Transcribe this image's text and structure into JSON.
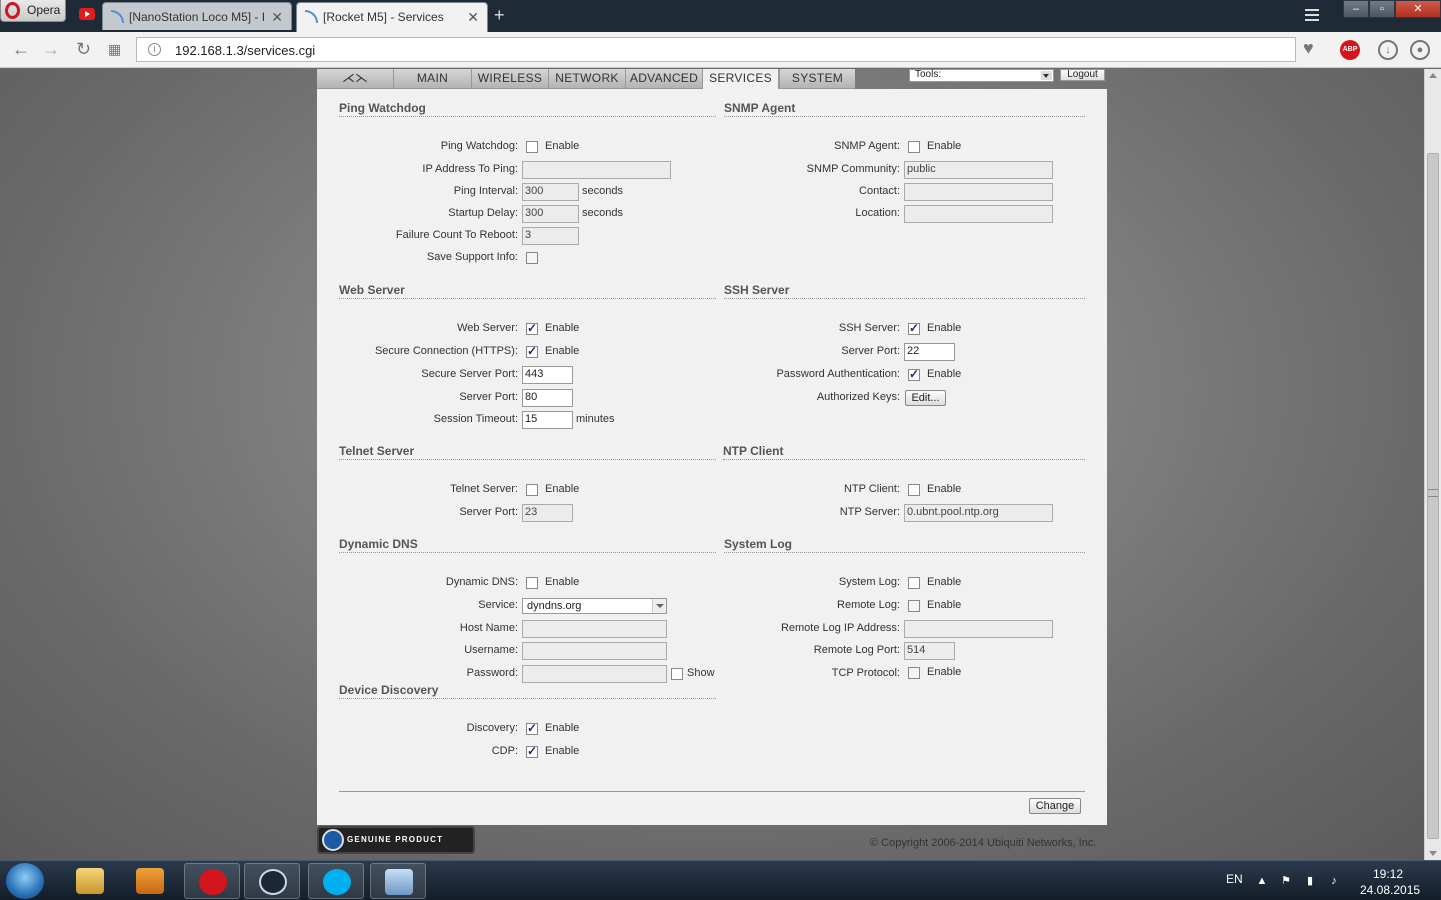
{
  "browser": {
    "menu_label": "Opera",
    "tabs": [
      {
        "title": "[NanoStation Loco M5] - I"
      },
      {
        "title": "[Rocket M5] - Services"
      }
    ],
    "url": "192.168.1.3/services.cgi",
    "abp_label": "ABP"
  },
  "nav": {
    "tabs": [
      "MAIN",
      "WIRELESS",
      "NETWORK",
      "ADVANCED",
      "SERVICES",
      "SYSTEM"
    ],
    "active": "SERVICES",
    "tools_label": "Tools:",
    "logout_label": "Logout"
  },
  "ping_watchdog": {
    "title": "Ping Watchdog",
    "ping_watchdog_label": "Ping Watchdog:",
    "enable_label": "Enable",
    "ip_label": "IP Address To Ping:",
    "ip_value": "",
    "interval_label": "Ping Interval:",
    "interval_value": "300",
    "interval_unit": "seconds",
    "startup_label": "Startup Delay:",
    "startup_value": "300",
    "startup_unit": "seconds",
    "failure_label": "Failure Count To Reboot:",
    "failure_value": "3",
    "support_label": "Save Support Info:"
  },
  "snmp": {
    "title": "SNMP Agent",
    "agent_label": "SNMP Agent:",
    "enable_label": "Enable",
    "community_label": "SNMP Community:",
    "community_value": "public",
    "contact_label": "Contact:",
    "contact_value": "",
    "location_label": "Location:",
    "location_value": ""
  },
  "web_server": {
    "title": "Web Server",
    "server_label": "Web Server:",
    "enable_label": "Enable",
    "https_label": "Secure Connection (HTTPS):",
    "https_enable_label": "Enable",
    "secure_port_label": "Secure Server Port:",
    "secure_port_value": "443",
    "port_label": "Server Port:",
    "port_value": "80",
    "timeout_label": "Session Timeout:",
    "timeout_value": "15",
    "timeout_unit": "minutes"
  },
  "ssh": {
    "title": "SSH Server",
    "server_label": "SSH Server:",
    "enable_label": "Enable",
    "port_label": "Server Port:",
    "port_value": "22",
    "password_label": "Password Authentication:",
    "password_enable_label": "Enable",
    "keys_label": "Authorized Keys:",
    "edit_label": "Edit..."
  },
  "telnet": {
    "title": "Telnet Server",
    "server_label": "Telnet Server:",
    "enable_label": "Enable",
    "port_label": "Server Port:",
    "port_value": "23"
  },
  "ntp": {
    "title": "NTP Client",
    "client_label": "NTP Client:",
    "enable_label": "Enable",
    "server_label": "NTP Server:",
    "server_value": "0.ubnt.pool.ntp.org"
  },
  "ddns": {
    "title": "Dynamic DNS",
    "ddns_label": "Dynamic DNS:",
    "enable_label": "Enable",
    "service_label": "Service:",
    "service_value": "dyndns.org",
    "host_label": "Host Name:",
    "host_value": "",
    "user_label": "Username:",
    "user_value": "",
    "pass_label": "Password:",
    "pass_value": "",
    "show_label": "Show"
  },
  "syslog": {
    "title": "System Log",
    "log_label": "System Log:",
    "enable_label": "Enable",
    "remote_label": "Remote Log:",
    "remote_enable_label": "Enable",
    "remote_ip_label": "Remote Log IP Address:",
    "remote_ip_value": "",
    "remote_port_label": "Remote Log Port:",
    "remote_port_value": "514",
    "tcp_label": "TCP Protocol:",
    "tcp_enable_label": "Enable"
  },
  "discovery": {
    "title": "Device Discovery",
    "discovery_label": "Discovery:",
    "enable_label": "Enable",
    "cdp_label": "CDP:",
    "cdp_enable_label": "Enable"
  },
  "footer": {
    "change_label": "Change",
    "genuine_label": "GENUINE PRODUCT",
    "copyright": "© Copyright 2006-2014 Ubiquiti Networks, Inc."
  },
  "taskbar": {
    "lang": "EN",
    "time": "19:12",
    "date": "24.08.2015"
  },
  "colors": {
    "panel_bg": "#f1f1f1",
    "nav_gradient_top": "#d6d6d6",
    "tab_bar": "#1f2a37",
    "abp_red": "#d3151e",
    "check_blue": "#1a2d70"
  },
  "icons": [
    "opera-logo-icon",
    "youtube-icon",
    "rss-icon",
    "back-icon",
    "forward-icon",
    "reload-icon",
    "speed-dial-icon",
    "site-info-icon",
    "heart-icon",
    "abp-icon",
    "download-icon",
    "user-icon",
    "ubiquiti-logo-icon",
    "lock-icon"
  ]
}
